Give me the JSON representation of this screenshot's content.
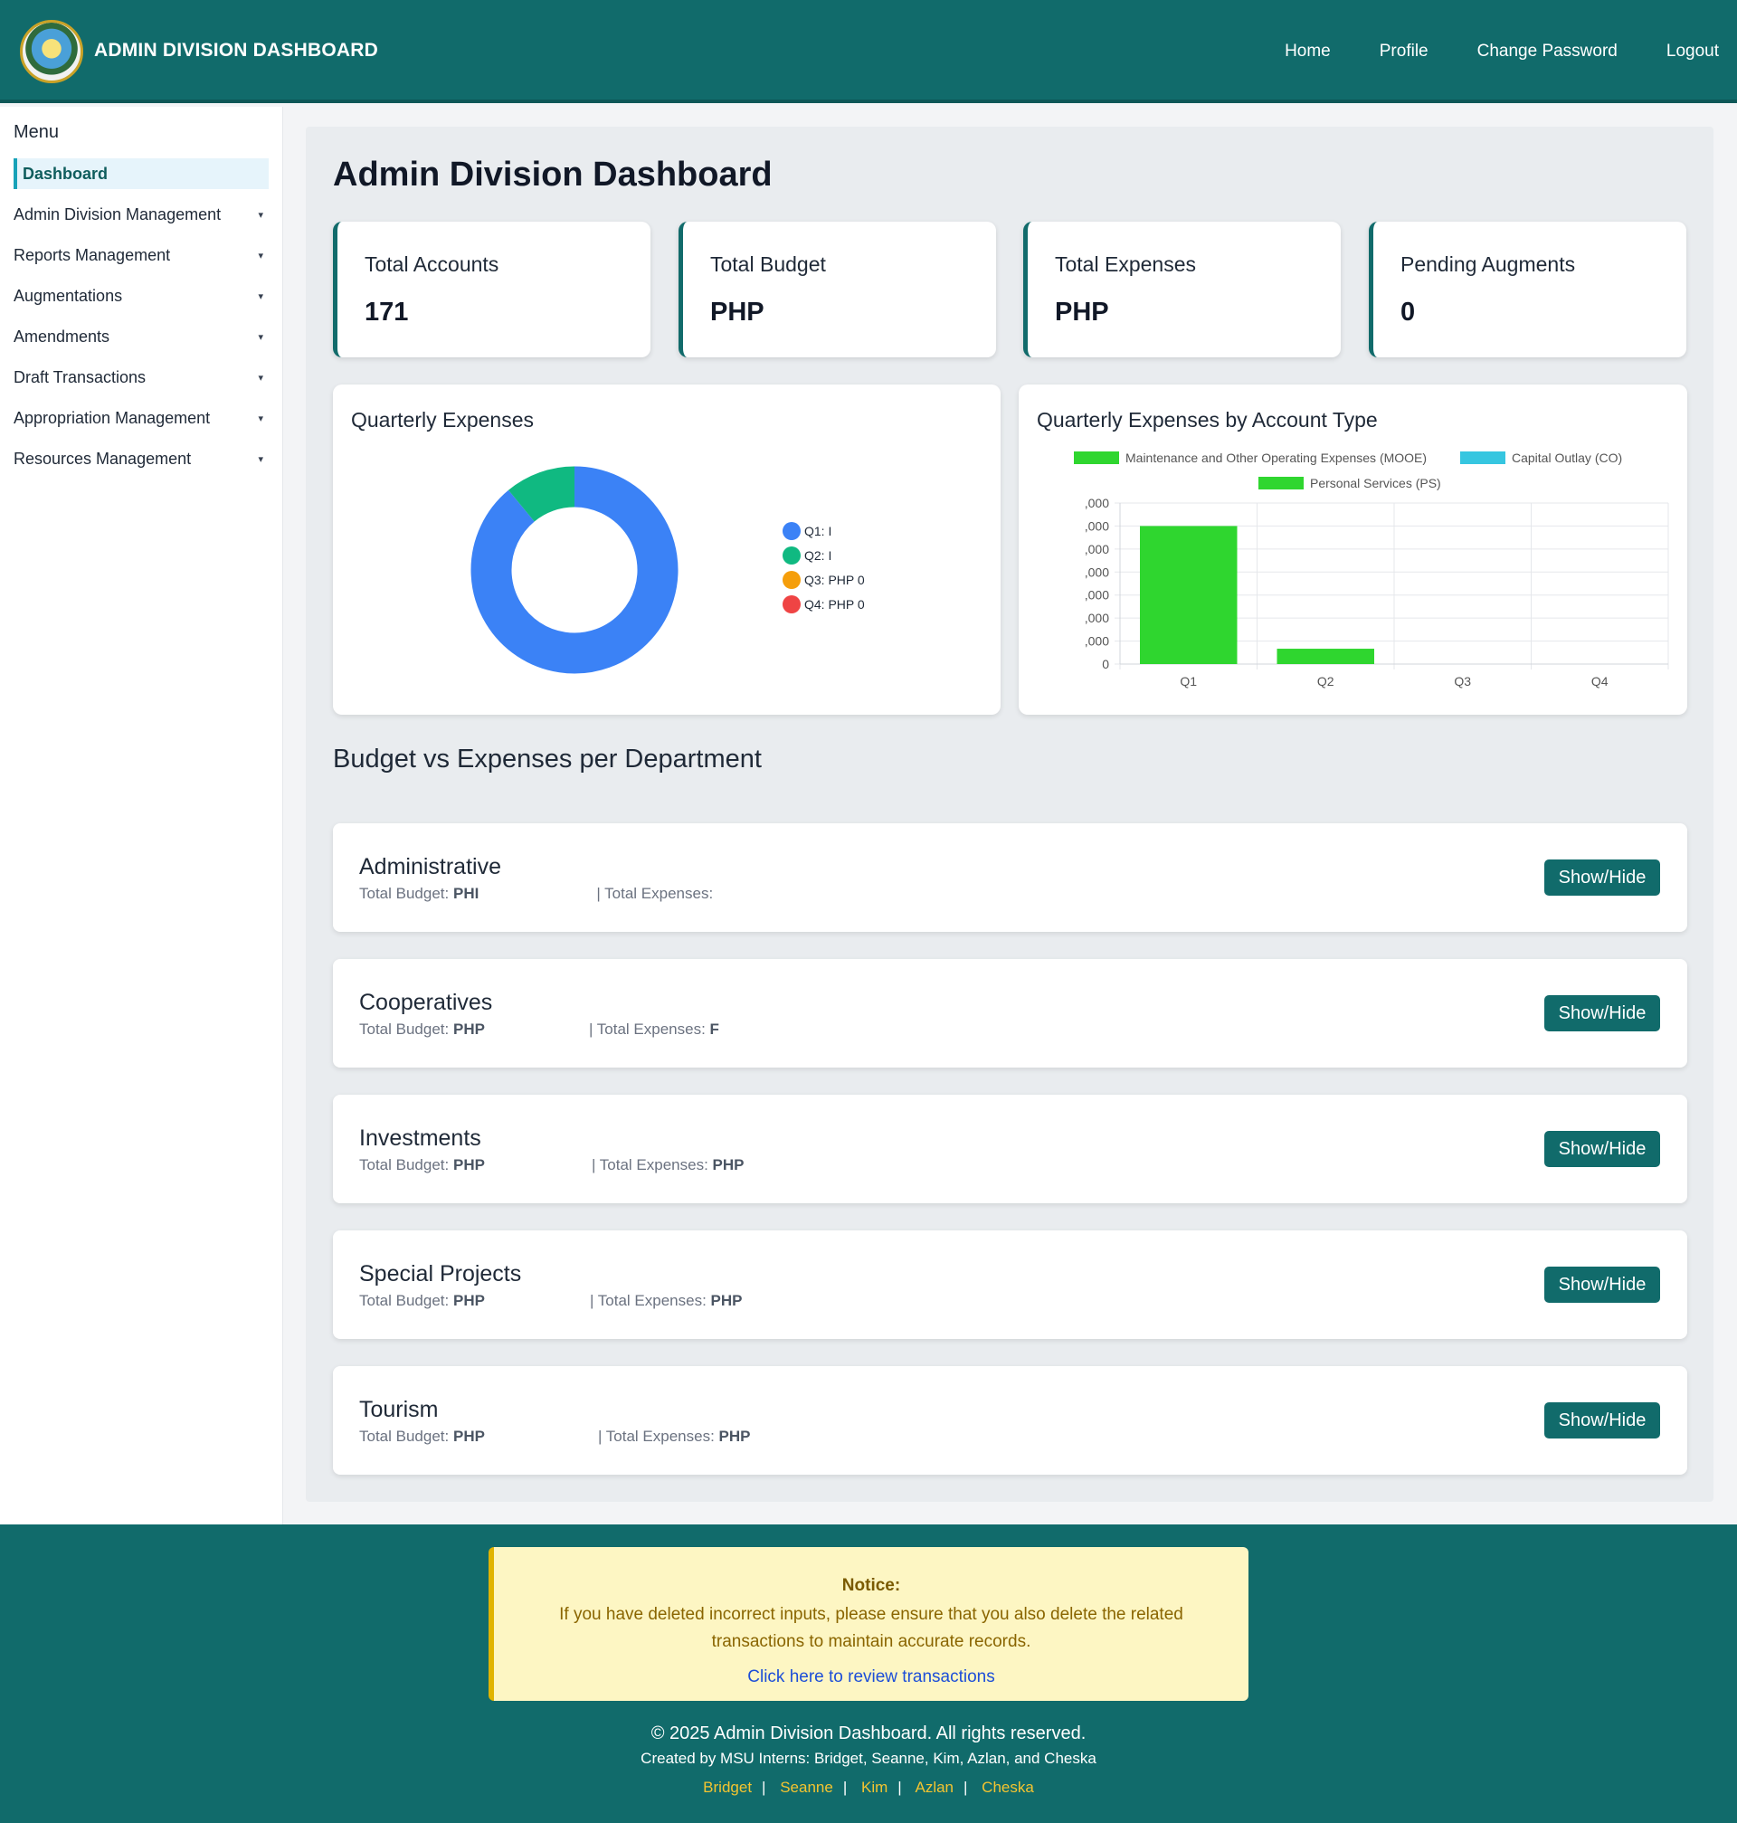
{
  "header": {
    "title": "ADMIN DIVISION DASHBOARD",
    "nav": [
      "Home",
      "Profile",
      "Change Password",
      "Logout"
    ]
  },
  "sidebar": {
    "title": "Menu",
    "items": [
      {
        "label": "Dashboard",
        "active": true
      },
      {
        "label": "Admin Division Management",
        "caret": "▾"
      },
      {
        "label": "Reports Management",
        "caret": "▾"
      },
      {
        "label": "Augmentations",
        "caret": "▾"
      },
      {
        "label": "Amendments",
        "caret": "▾"
      },
      {
        "label": "Draft Transactions",
        "caret": "▾"
      },
      {
        "label": "Appropriation Management",
        "caret": "▾"
      },
      {
        "label": "Resources Management",
        "caret": "▾"
      }
    ]
  },
  "main": {
    "title": "Admin Division Dashboard",
    "stats": [
      {
        "label": "Total Accounts",
        "value": "171"
      },
      {
        "label": "Total Budget",
        "value": "PHP"
      },
      {
        "label": "Total Expenses",
        "value": "PHP"
      },
      {
        "label": "Pending Augments",
        "value": "0"
      }
    ],
    "section_title": "Budget vs Expenses per Department",
    "departments": [
      {
        "name": "Administrative",
        "budget_label": "Total Budget:",
        "budget_value": "PHI",
        "expenses_label": "| Total Expenses:",
        "expenses_value": "",
        "button": "Show/Hide"
      },
      {
        "name": "Cooperatives",
        "budget_label": "Total Budget:",
        "budget_value": "PHP",
        "expenses_label": "| Total Expenses:",
        "expenses_value": "F",
        "button": "Show/Hide"
      },
      {
        "name": "Investments",
        "budget_label": "Total Budget:",
        "budget_value": "PHP",
        "expenses_label": "| Total Expenses:",
        "expenses_value": "PHP",
        "button": "Show/Hide"
      },
      {
        "name": "Special Projects",
        "budget_label": "Total Budget:",
        "budget_value": "PHP",
        "expenses_label": "| Total Expenses:",
        "expenses_value": "PHP",
        "button": "Show/Hide"
      },
      {
        "name": "Tourism",
        "budget_label": "Total Budget:",
        "budget_value": "PHP",
        "expenses_label": "| Total Expenses:",
        "expenses_value": "PHP",
        "button": "Show/Hide"
      }
    ]
  },
  "chart_data": [
    {
      "type": "pie",
      "title": "Quarterly Expenses",
      "categories": [
        "Q1: I",
        "Q2: I",
        "Q3: PHP 0",
        "Q4: PHP 0"
      ],
      "values": [
        89,
        11,
        0,
        0
      ],
      "colors": [
        "#3b82f6",
        "#10b981",
        "#f59e0b",
        "#ef4444"
      ],
      "legend": "right"
    },
    {
      "type": "bar",
      "title": "Quarterly Expenses by Account Type",
      "categories": [
        "Q1",
        "Q2",
        "Q3",
        "Q4"
      ],
      "series": [
        {
          "name": "Maintenance and Other Operating Expenses (MOOE)",
          "values": [
            90,
            10,
            0,
            0
          ],
          "color": "#2fd62f"
        },
        {
          "name": "Capital Outlay (CO)",
          "values": [
            0,
            0,
            0,
            0
          ],
          "color": "#36c6e0"
        },
        {
          "name": "Personal Services (PS)",
          "values": [
            0,
            0,
            0,
            0
          ],
          "color": "#2fd62f"
        }
      ],
      "yticks": [
        "0",
        ",000",
        ",000",
        ",000",
        ",000",
        ",000",
        ",000",
        ",000"
      ],
      "ylim": [
        0,
        105
      ],
      "legend": "top",
      "grid": true
    }
  ],
  "footer": {
    "notice_title": "Notice:",
    "notice_message": "If you have deleted incorrect inputs, please ensure that you also delete the related transactions to maintain accurate records.",
    "notice_link": "Click here to review transactions",
    "copyright": "© 2025 Admin Division Dashboard. All rights reserved.",
    "credits": "Created by MSU Interns: Bridget, Seanne, Kim, Azlan, and Cheska",
    "links": [
      "Bridget",
      "Seanne",
      "Kim",
      "Azlan",
      "Cheska"
    ]
  }
}
